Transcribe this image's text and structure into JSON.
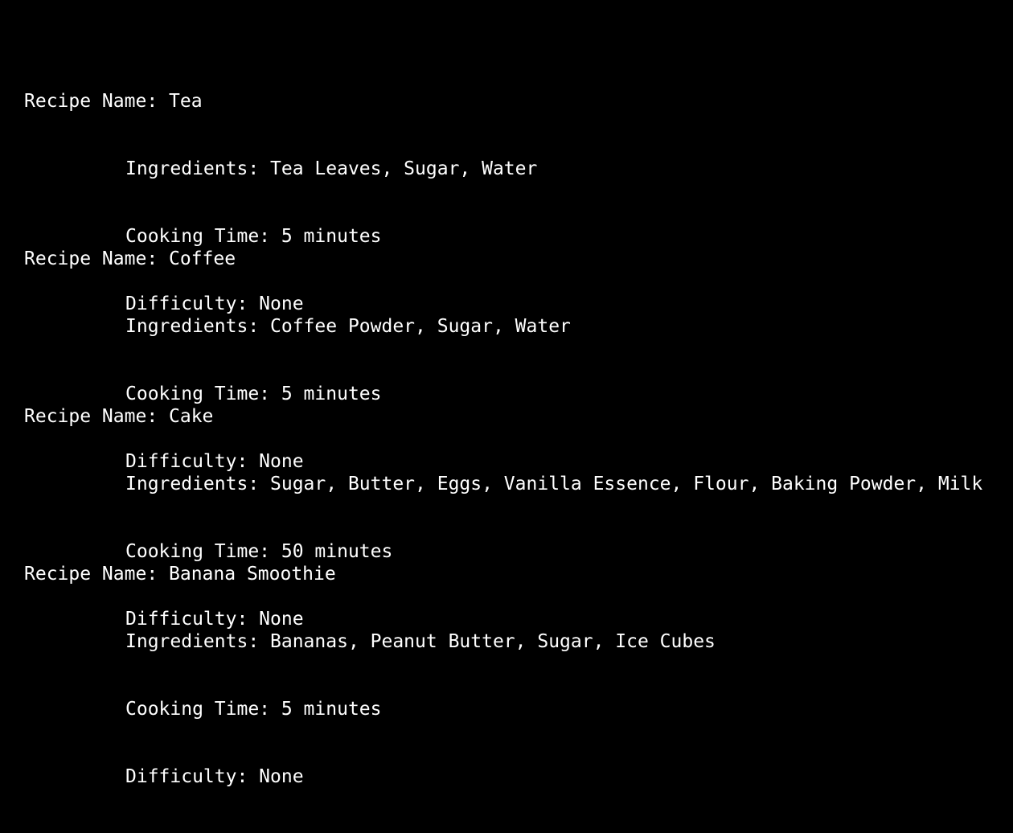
{
  "terminal": {
    "recipes": [
      {
        "name_line": "Recipe Name: Tea",
        "ingredients_line": "Ingredients: Tea Leaves, Sugar, Water",
        "cooking_time_line": "Cooking Time: 5 minutes",
        "difficulty_line": "Difficulty: None"
      },
      {
        "name_line": "Recipe Name: Coffee",
        "ingredients_line": "Ingredients: Coffee Powder, Sugar, Water",
        "cooking_time_line": "Cooking Time: 5 minutes",
        "difficulty_line": "Difficulty: None"
      },
      {
        "name_line": "Recipe Name: Cake",
        "ingredients_line": "Ingredients: Sugar, Butter, Eggs, Vanilla Essence, Flour, Baking Powder, Milk",
        "cooking_time_line": "Cooking Time: 50 minutes",
        "difficulty_line": "Difficulty: None"
      },
      {
        "name_line": "Recipe Name: Banana Smoothie",
        "ingredients_line": "Ingredients: Bananas, Peanut Butter, Sugar, Ice Cubes",
        "cooking_time_line": "Cooking Time: 5 minutes",
        "difficulty_line": "Difficulty: None"
      }
    ],
    "colors": {
      "background": "#000000",
      "text": "#ffffff"
    }
  }
}
